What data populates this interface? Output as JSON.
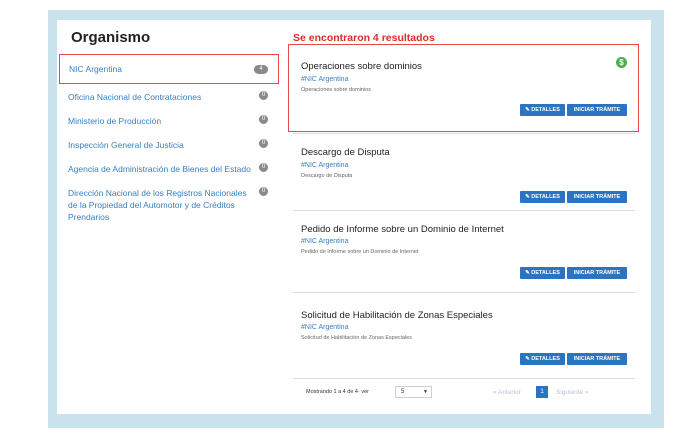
{
  "sidebar": {
    "title": "Organismo",
    "items": [
      {
        "label": "NIC Argentina",
        "count": "4"
      },
      {
        "label": "Oficina Nacional de Contrataciones",
        "count": "0"
      },
      {
        "label": "Ministerio de Producción",
        "count": "0"
      },
      {
        "label": "Inspección General de Justicia",
        "count": "0"
      },
      {
        "label": "Agencia de Administración de Bienes del Estado",
        "count": "0"
      },
      {
        "label": "Dirección Nacional de los Registros Nacionales de la Propiedad del Automotor y de Créditos Prendarios",
        "count": "0"
      }
    ]
  },
  "results": {
    "header": "Se encontraron 4 resultados",
    "cards": [
      {
        "title": "Operaciones sobre dominios",
        "org": "#NIC Argentina",
        "desc": "Operaciones sobre dominios",
        "paid_icon": "dollar-icon"
      },
      {
        "title": "Descargo de Disputa",
        "org": "#NIC Argentina",
        "desc": "Descargo de Disputa"
      },
      {
        "title": "Pedido de Informe sobre un Dominio de Internet",
        "org": "#NIC Argentina",
        "desc": "Pedido de Informe sobre un Dominio de Internet"
      },
      {
        "title": "Solicitud de Habilitación de Zonas Especiales",
        "org": "#NIC Argentina",
        "desc": "Solicitud de Habilitación de Zonas Especiales"
      }
    ],
    "details_label": "✎ DETALLES",
    "start_label": "INICIAR TRÁMITE"
  },
  "pagination": {
    "showing": "Mostrando 1 a 4 de 4· ver",
    "per_page": "5",
    "prev": "«  Anterior",
    "page": "1",
    "next": "Siguiente  »"
  },
  "colors": {
    "accent": "#2b74c1",
    "highlight": "#e54a4a",
    "frame": "#c9e3ec",
    "paid": "#4caf50"
  }
}
